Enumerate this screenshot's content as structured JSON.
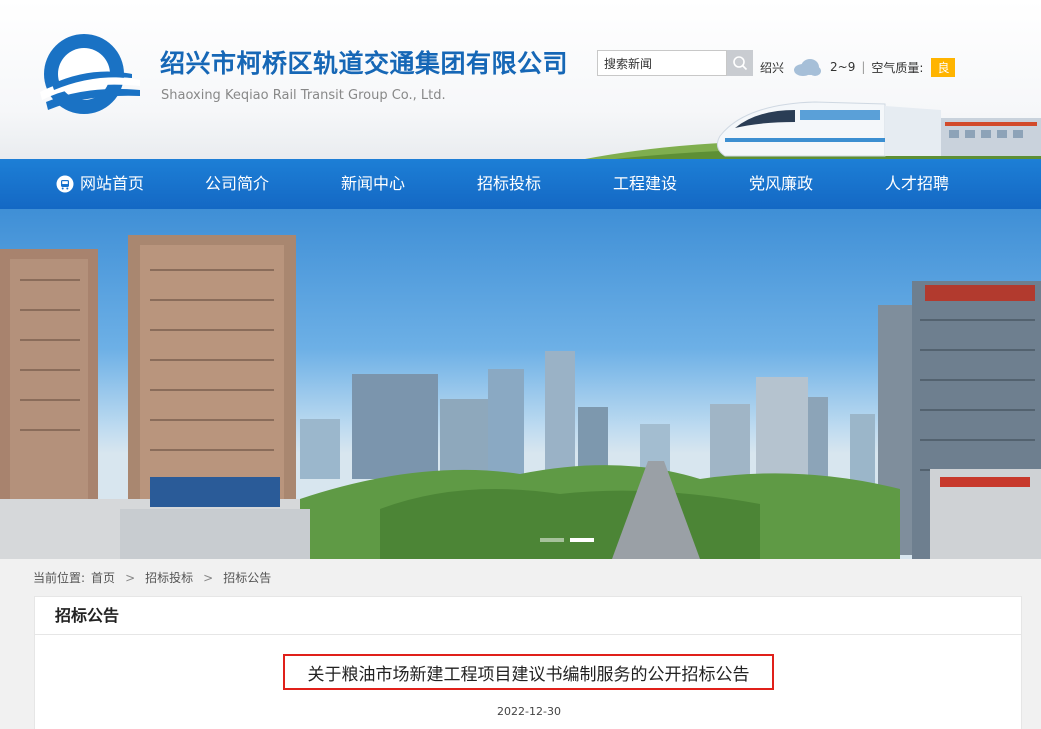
{
  "header": {
    "title_cn": "绍兴市柯桥区轨道交通集团有限公司",
    "title_en": "Shaoxing Keqiao Rail Transit Group Co., Ltd.",
    "search_placeholder": "搜索新闻",
    "weather": {
      "city": "绍兴",
      "icon": "cloud-icon",
      "temp": "2~9",
      "sep": "|",
      "aq_label": "空气质量:",
      "aq_value": "良"
    }
  },
  "nav": {
    "items": [
      {
        "label": "网站首页",
        "icon": "home-icon"
      },
      {
        "label": "公司简介"
      },
      {
        "label": "新闻中心"
      },
      {
        "label": "招标投标"
      },
      {
        "label": "工程建设"
      },
      {
        "label": "党风廉政"
      },
      {
        "label": "人才招聘"
      }
    ]
  },
  "banner": {
    "slides": 2,
    "active_slide": 2
  },
  "breadcrumb": {
    "prefix": "当前位置:",
    "items": [
      "首页",
      "招标投标",
      "招标公告"
    ],
    "separator": ">"
  },
  "panel": {
    "heading": "招标公告",
    "article_title": "关于粮油市场新建工程项目建议书编制服务的公开招标公告",
    "article_date": "2022-12-30"
  },
  "colors": {
    "brand_blue": "#1667b6",
    "nav_blue": "#1872cc",
    "highlight_red": "#e0201a",
    "aq_badge": "#ffb400"
  }
}
